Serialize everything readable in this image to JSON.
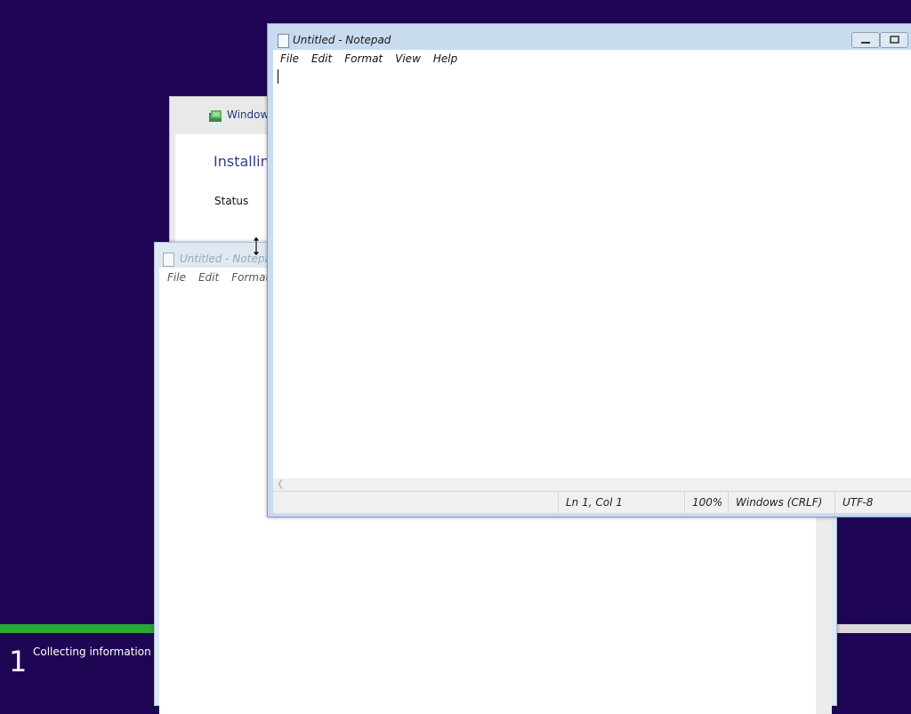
{
  "setup": {
    "window_title": "Windows",
    "heading": "Installing",
    "status_label": "Status"
  },
  "progress": {
    "step_number": "1",
    "step_label": "Collecting information",
    "fraction": 0.17
  },
  "notepad_back": {
    "title": "Untitled - Notepad",
    "menu": [
      "File",
      "Edit",
      "Format"
    ]
  },
  "notepad_front": {
    "title": "Untitled - Notepad",
    "menu": [
      "File",
      "Edit",
      "Format",
      "View",
      "Help"
    ],
    "status": {
      "position": "Ln 1, Col 1",
      "zoom": "100%",
      "line_ending": "Windows (CRLF)",
      "encoding": "UTF-8"
    }
  },
  "colors": {
    "desktop": "#1e0654",
    "progress": "#2aa838"
  }
}
